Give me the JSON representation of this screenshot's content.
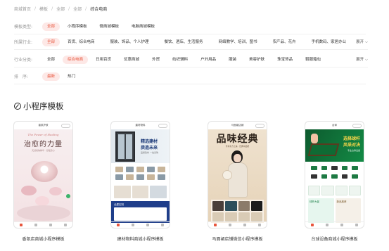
{
  "breadcrumb": [
    "商城首页",
    "模板",
    "全部",
    "全部",
    "综合电商"
  ],
  "filters": {
    "type": {
      "label": "模板类型:",
      "options": [
        "全部",
        "小程序模板",
        "微商城模板",
        "电脑商城模板"
      ],
      "active": 0
    },
    "industry": {
      "label": "所属行业:",
      "options": [
        "全部",
        "百货、综合电商",
        "服装、饰品、个人护理",
        "餐饮、酒店、生活服务",
        "网络教学、培训、图书",
        "农产品、花卉",
        "手机数码、家居办公"
      ],
      "active": 0,
      "expand": "展开 ⌵"
    },
    "category": {
      "label": "行业分类:",
      "options": [
        "全部",
        "综合电商",
        "日用百货",
        "优惠商城",
        "外贸",
        "纺织辅料",
        "户外用品",
        "服装",
        "美容护肤",
        "珠宝饰品",
        "鞋服箱包"
      ],
      "active": 1,
      "expand": "展开 ⌵"
    },
    "sort": {
      "label": "排　序:",
      "options": [
        "最新",
        "热门"
      ],
      "active": 0
    }
  },
  "section_title": "小程序模板",
  "cards": [
    {
      "name": "香氛店商城小程序模板",
      "screen": {
        "top": "香氛护肤",
        "eng": "The Power of Healing",
        "cn": "治愈的力量",
        "sub": "天然植物精华 · 舒缓身心"
      }
    },
    {
      "name": "建材物料商城小程序模板",
      "screen": {
        "top": "建材物料",
        "t1": "精选建材",
        "t2": "质造未来",
        "t3": "品质建材 一站采购",
        "banner": "全屋定制"
      }
    },
    {
      "name": "马面裙店铺微信小程序模板",
      "screen": {
        "top": "马面裙店铺",
        "title": "品味经典",
        "sub": "传承东方之美 · 经典马面裙"
      }
    },
    {
      "name": "台球设备商城小程序模板",
      "screen": {
        "top": "台球",
        "h1": "选择球杆",
        "h2": "风采对决",
        "h3": "专业台球设备",
        "promo1": "球杆大促",
        "promo2": "新品推荐"
      }
    }
  ],
  "colors": {
    "accent": "#e8553c",
    "accent_bg": "#fde8e6"
  }
}
